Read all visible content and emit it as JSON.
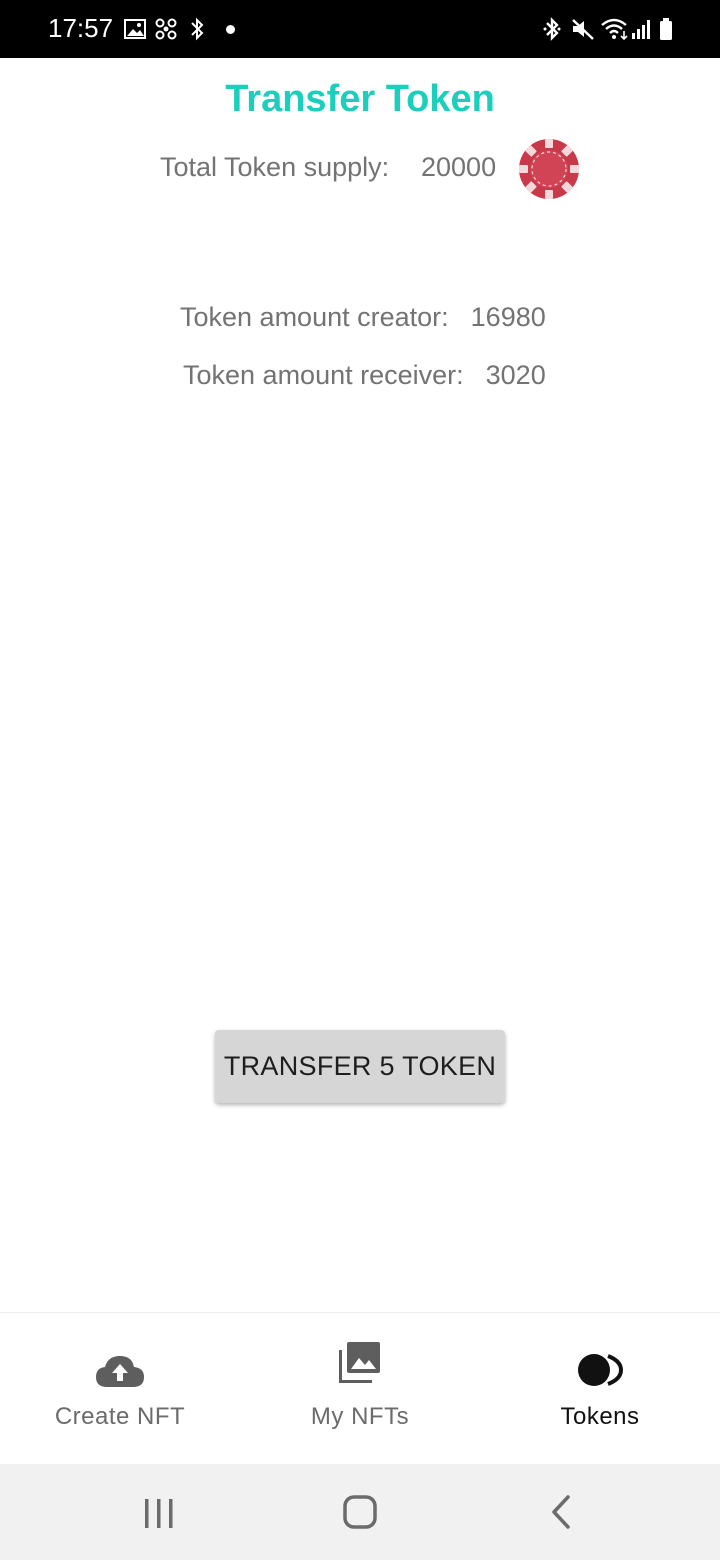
{
  "status_bar": {
    "time": "17:57",
    "left_icons": [
      "gallery-icon",
      "fan-icon",
      "bluetooth-icon",
      "notification-dot-icon"
    ],
    "right_icons": [
      "bluetooth-icon",
      "mute-icon",
      "wifi-icon",
      "signal-icon",
      "battery-icon"
    ]
  },
  "header": {
    "title": "Transfer Token",
    "title_color": "#1ccfbc"
  },
  "supply": {
    "label": "Total Token supply:",
    "value": "20000",
    "icon": "poker-chip-icon",
    "icon_color": "#c8394a"
  },
  "amounts": {
    "creator_label": "Token amount creator:",
    "creator_value": "16980",
    "receiver_label": "Token amount receiver:",
    "receiver_value": "3020"
  },
  "transfer_button": {
    "label": "TRANSFER 5 TOKEN"
  },
  "bottom_nav": {
    "items": [
      {
        "label": "Create NFT",
        "icon": "cloud-upload-icon",
        "active": false
      },
      {
        "label": "My NFTs",
        "icon": "photo-library-icon",
        "active": false
      },
      {
        "label": "Tokens",
        "icon": "tokens-icon",
        "active": true
      }
    ]
  },
  "system_nav": {
    "buttons": [
      "recents-icon",
      "home-icon",
      "back-icon"
    ]
  }
}
